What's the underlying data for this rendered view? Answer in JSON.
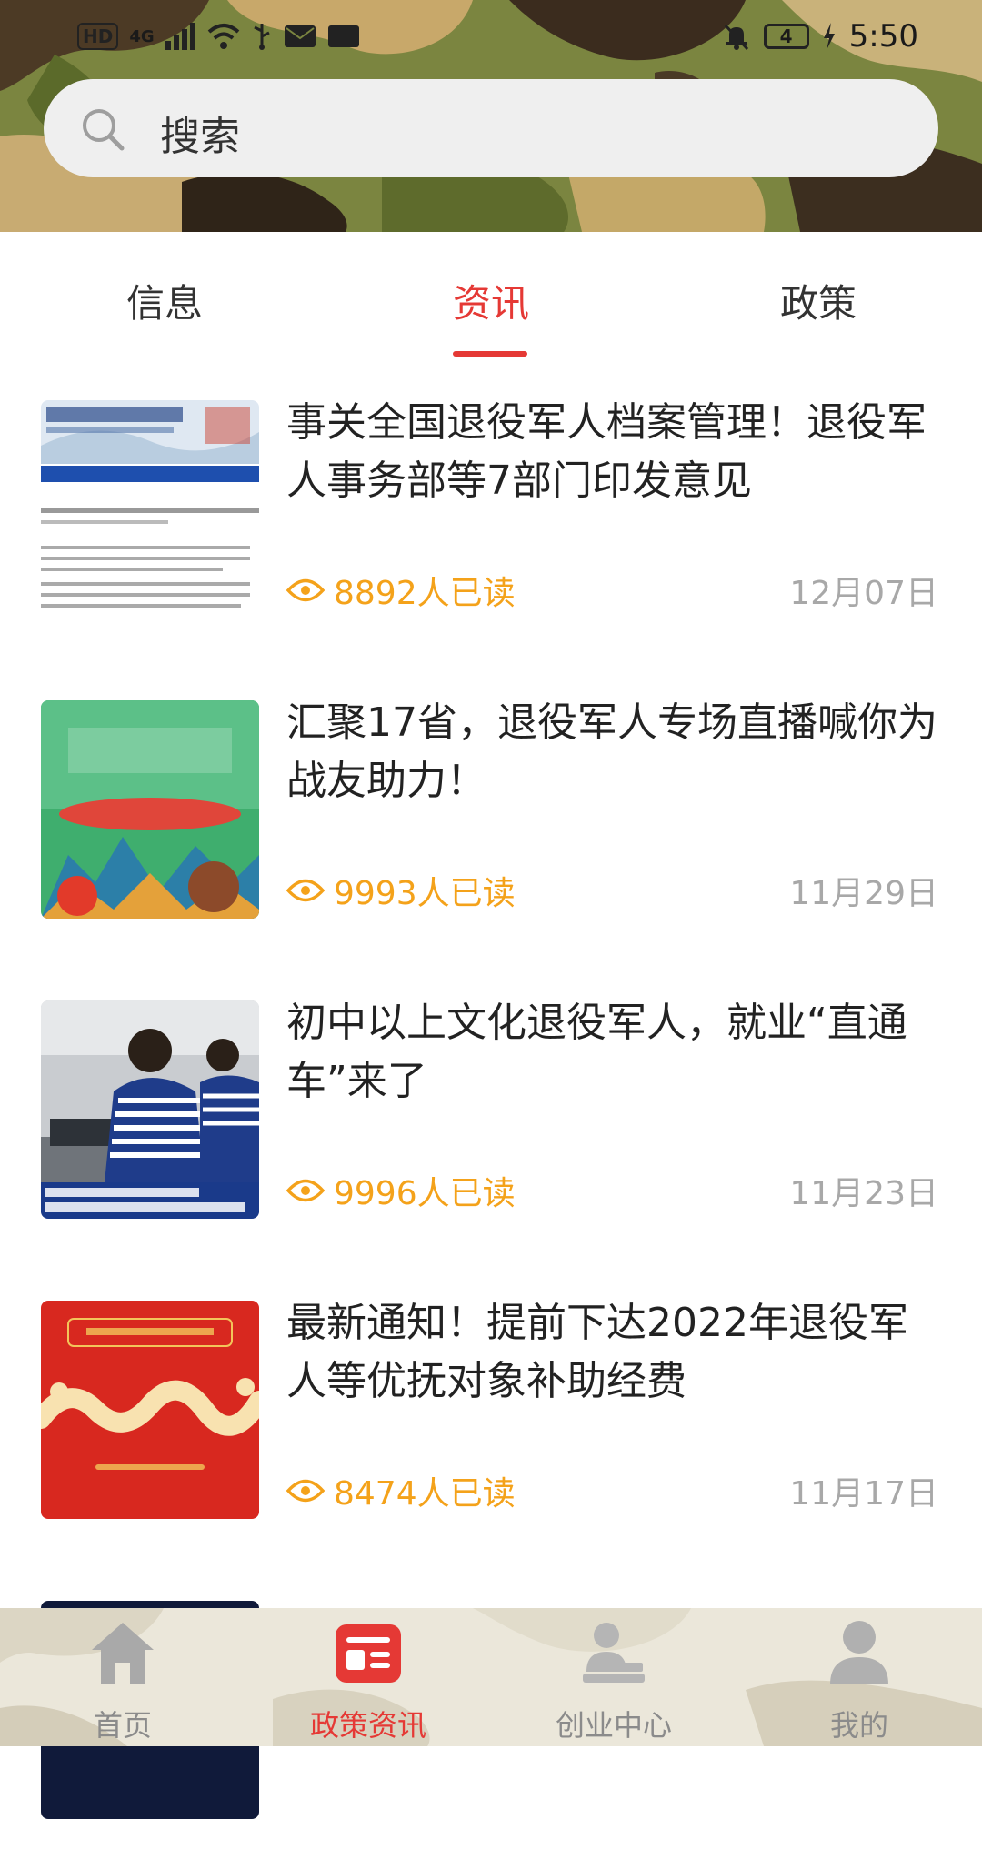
{
  "status_bar": {
    "left_icons": [
      "HD",
      "4G",
      "signal-icon",
      "wifi-icon",
      "usb-icon",
      "mail-icon",
      "nfc-icon"
    ],
    "right_icons": [
      "bell-off-icon",
      "battery-icon"
    ],
    "battery_level": "4",
    "time": "5:50"
  },
  "search": {
    "placeholder": "搜索"
  },
  "tabs": [
    {
      "label": "信息",
      "active": false
    },
    {
      "label": "资讯",
      "active": true
    },
    {
      "label": "政策",
      "active": false
    }
  ],
  "news": [
    {
      "title": "事关全国退役军人档案管理！退役军人事务部等7部门印发意见",
      "reads": "8892人已读",
      "date": "12月07日",
      "thumb": "document-screenshot"
    },
    {
      "title": "汇聚17省，退役军人专场直播喊你为战友助力！",
      "reads": "9993人已读",
      "date": "11月29日",
      "thumb": "hero-poster"
    },
    {
      "title": "初中以上文化退役军人，就业“直通车”来了",
      "reads": "9996人已读",
      "date": "11月23日",
      "thumb": "training-photo"
    },
    {
      "title": "最新通知！提前下达2022年退役军人等优抚对象补助经费",
      "reads": "8474人已读",
      "date": "11月17日",
      "thumb": "red-notice"
    }
  ],
  "bottom_nav": [
    {
      "label": "首页",
      "icon": "home-icon",
      "active": false
    },
    {
      "label": "政策资讯",
      "icon": "news-icon",
      "active": true
    },
    {
      "label": "创业中心",
      "icon": "business-icon",
      "active": false
    },
    {
      "label": "我的",
      "icon": "user-icon",
      "active": false
    }
  ],
  "colors": {
    "accent": "#e53935",
    "reads": "#f4a21a",
    "date": "#a8a8a8"
  }
}
